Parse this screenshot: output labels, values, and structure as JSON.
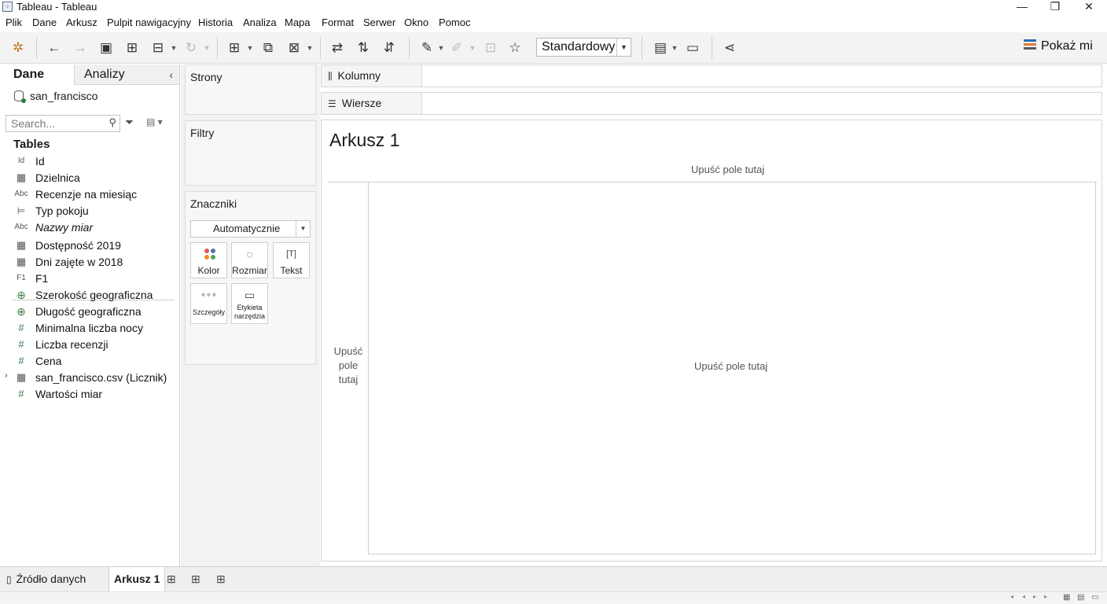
{
  "window": {
    "title": "Tableau - Tableau",
    "minimize": "—",
    "maximize": "❐",
    "close": "✕"
  },
  "menu": [
    "Plik",
    "Dane",
    "Arkusz",
    "Pulpit nawigacyjny",
    "Historia",
    "Analiza",
    "Mapa",
    "Format",
    "Serwer",
    "Okno",
    "Pomoc"
  ],
  "toolbar": {
    "fit_select": "Standardowy",
    "show_me": "Pokaż mi"
  },
  "data_pane": {
    "tab_data": "Dane",
    "tab_analytics": "Analizy",
    "datasource": "san_francisco",
    "search_placeholder": "Search...",
    "tables_header": "Tables",
    "fields": [
      {
        "icon": "Id",
        "name": "Id",
        "kind": "id"
      },
      {
        "icon": "▦",
        "name": "Dzielnica",
        "kind": "table"
      },
      {
        "icon": "Abc",
        "name": "Recenzje na miesiąc",
        "kind": "string"
      },
      {
        "icon": "⊨",
        "name": "Typ pokoju",
        "kind": "bed"
      },
      {
        "icon": "Abc",
        "name": "Nazwy miar",
        "kind": "string"
      },
      {
        "icon": "▦",
        "name": "Dostępność 2019",
        "kind": "table"
      },
      {
        "icon": "▦",
        "name": "Dni zajęte w 2018",
        "kind": "table"
      },
      {
        "icon": "F1",
        "name": "F1",
        "kind": "f1"
      },
      {
        "icon": "⊕",
        "name": "Szerokość geograficzna",
        "kind": "geo"
      },
      {
        "icon": "⊕",
        "name": "Długość geograficzna",
        "kind": "geo"
      },
      {
        "icon": "#",
        "name": "Minimalna liczba nocy",
        "kind": "number"
      },
      {
        "icon": "#",
        "name": "Liczba recenzji",
        "kind": "number"
      },
      {
        "icon": "#",
        "name": "Cena",
        "kind": "number"
      },
      {
        "icon": "▦",
        "name": "san_francisco.csv (Licznik)",
        "kind": "table"
      },
      {
        "icon": "#",
        "name": "Wartości miar",
        "kind": "number"
      }
    ]
  },
  "cards": {
    "pages": "Strony",
    "filters": "Filtry",
    "marks": "Znaczniki",
    "marks_type": "Automatycznie",
    "mark_buttons": {
      "color": "Kolor",
      "size": "Rozmiar",
      "text": "Tekst",
      "detail": "Szczegóły",
      "tooltip": "Etykieta narzędzia"
    }
  },
  "shelves": {
    "columns": "Kolumny",
    "rows": "Wiersze"
  },
  "sheet": {
    "title": "Arkusz 1",
    "drop_top": "Upuść pole tutaj",
    "drop_left": "Upuść pole tutaj",
    "drop_main": "Upuść pole tutaj"
  },
  "bottom_tabs": {
    "datasource": "Źródło danych",
    "sheet1": "Arkusz 1"
  }
}
